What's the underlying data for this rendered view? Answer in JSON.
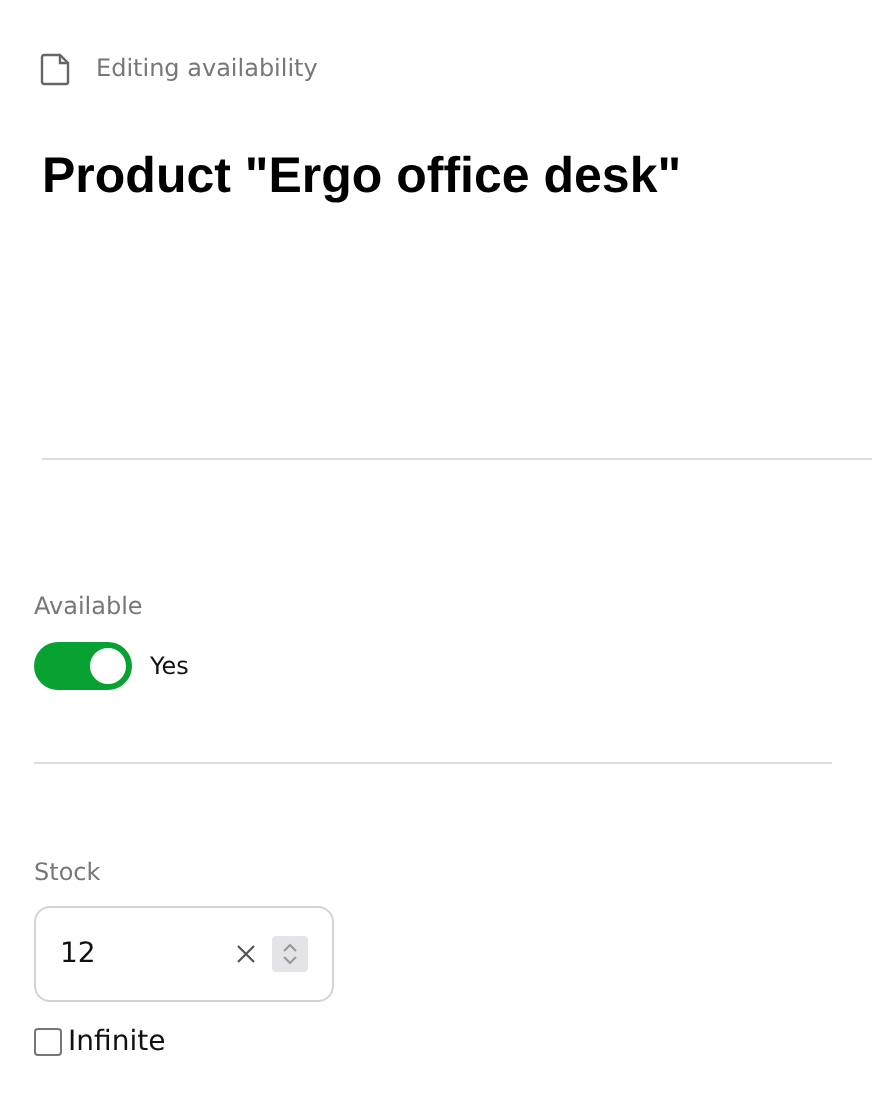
{
  "header": {
    "breadcrumb": "Editing availability",
    "title": "Product \"Ergo office desk\""
  },
  "available": {
    "label": "Available",
    "on": true,
    "state_text": "Yes"
  },
  "stock": {
    "label": "Stock",
    "value": "12"
  },
  "infinite": {
    "label": "Infinite",
    "checked": false
  }
}
